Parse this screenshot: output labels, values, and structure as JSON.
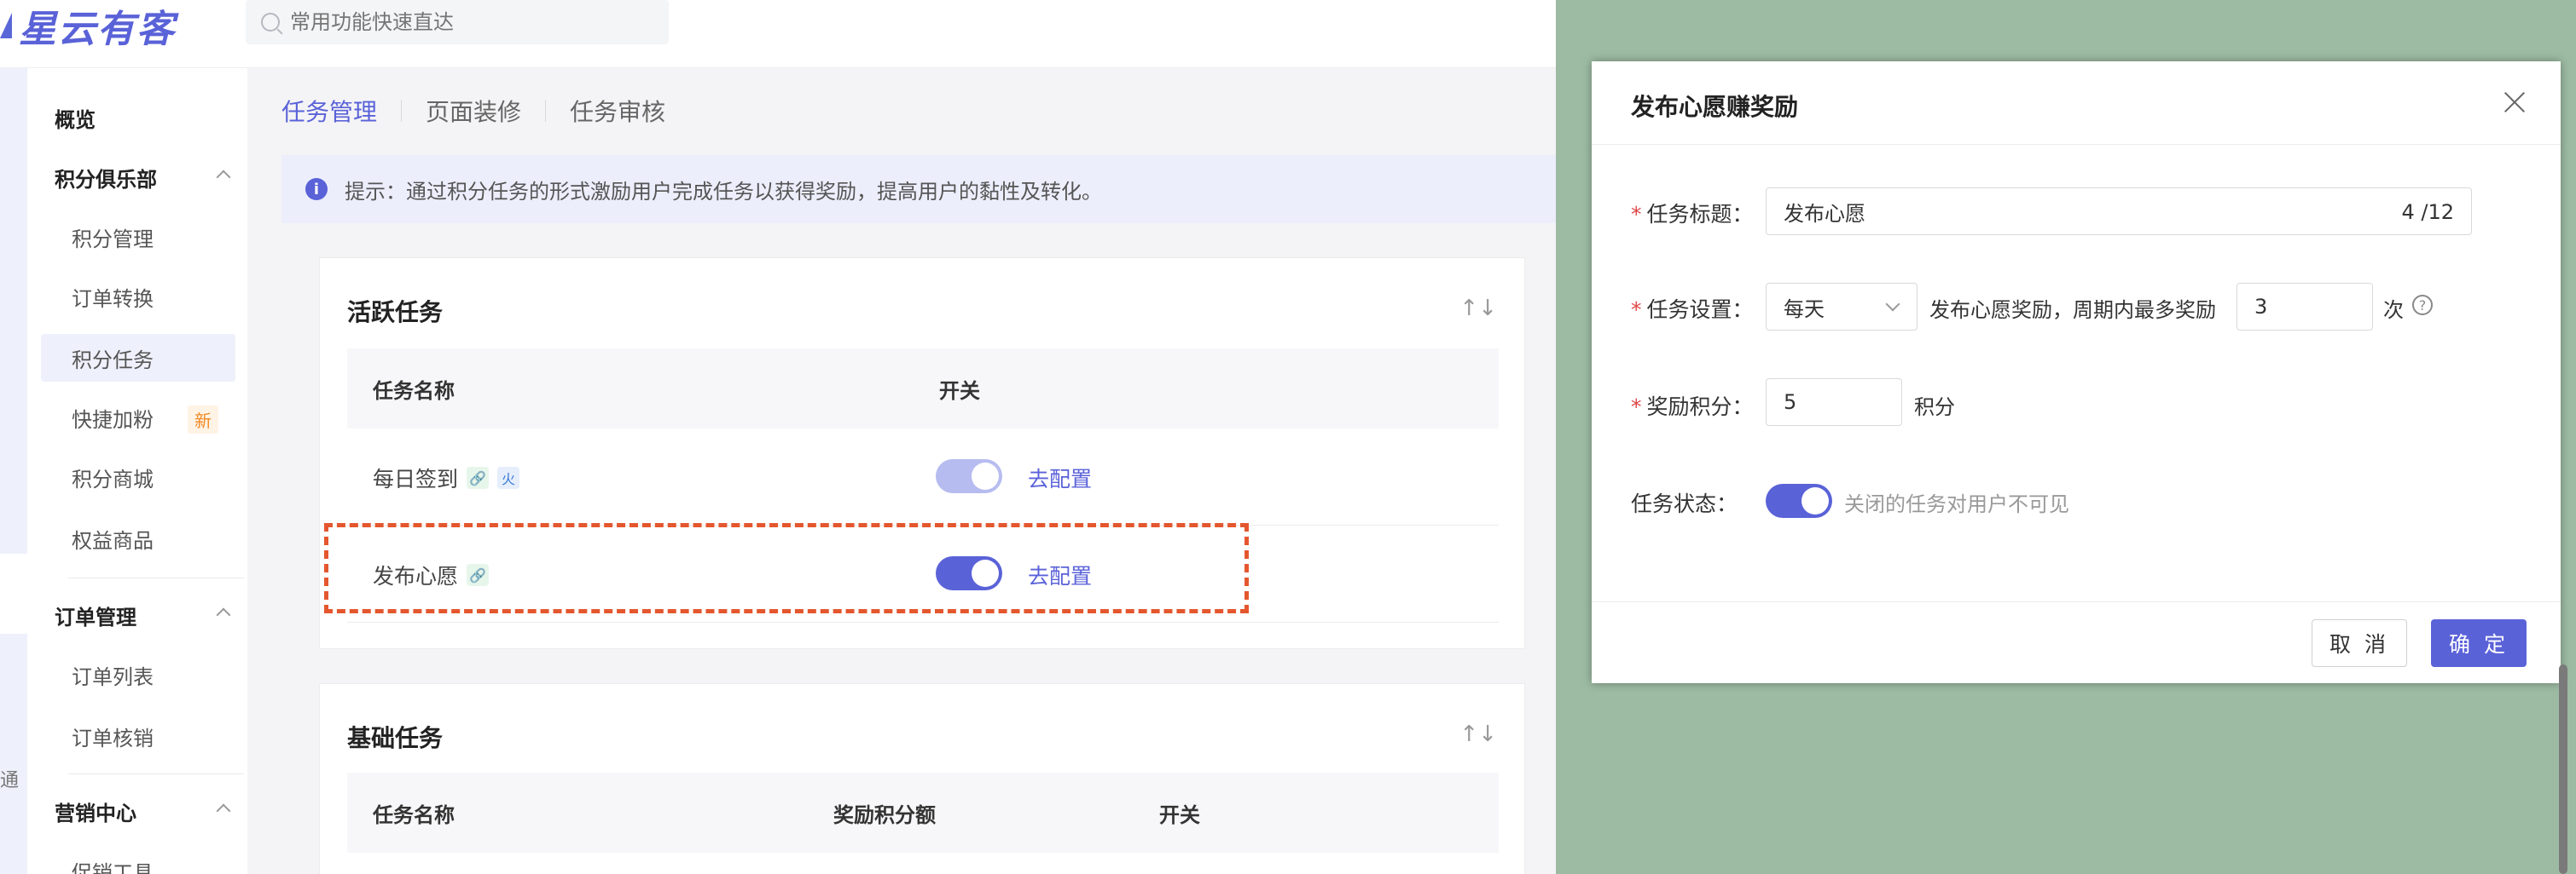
{
  "app": {
    "logo_text": "星云有客"
  },
  "search": {
    "placeholder": "常用功能快速直达"
  },
  "rail": {
    "label": "通"
  },
  "sidebar": {
    "overview": "概览",
    "groups": [
      {
        "label": "积分俱乐部",
        "items": [
          "积分管理",
          "订单转换",
          "积分任务",
          "快捷加粉",
          "积分商城",
          "权益商品"
        ]
      },
      {
        "label": "订单管理",
        "items": [
          "订单列表",
          "订单核销"
        ]
      },
      {
        "label": "营销中心",
        "items": [
          "促销工具"
        ]
      }
    ],
    "badge_new": "新"
  },
  "tabs": [
    "任务管理",
    "页面装修",
    "任务审核"
  ],
  "notice": {
    "icon": "i",
    "text": "提示：通过积分任务的形式激励用户完成任务以获得奖励，提高用户的黏性及转化。"
  },
  "active_tasks": {
    "title": "活跃任务",
    "sort_icon": "↑↓",
    "columns": [
      "任务名称",
      "开关"
    ],
    "rows": [
      {
        "name": "每日签到",
        "toggle_on": true,
        "disabled": true,
        "action": "去配置"
      },
      {
        "name": "发布心愿",
        "toggle_on": true,
        "disabled": false,
        "action": "去配置"
      }
    ]
  },
  "basic_tasks": {
    "title": "基础任务",
    "sort_icon": "↑↓",
    "columns": [
      "任务名称",
      "奖励积分额",
      "开关"
    ]
  },
  "dialog": {
    "title": "发布心愿赚奖励",
    "fields": {
      "task_title": {
        "label": "任务标题：",
        "value": "发布心愿",
        "count": "4 /12",
        "required": "*"
      },
      "task_setting": {
        "label": "任务设置：",
        "period": "每天",
        "middle_text": "发布心愿奖励，周期内最多奖励",
        "max_value": "3",
        "unit": "次",
        "required": "*"
      },
      "reward_points": {
        "label": "奖励积分：",
        "value": "5",
        "unit": "积分",
        "required": "*"
      },
      "task_status": {
        "label": "任务状态：",
        "hint": "关闭的任务对用户不可见",
        "enabled": true
      }
    },
    "cancel_label": "取 消",
    "ok_label": "确 定"
  },
  "colors": {
    "accent": "#5a62d8",
    "backdrop": "#9dbba3",
    "highlight_border": "#e4572e"
  }
}
